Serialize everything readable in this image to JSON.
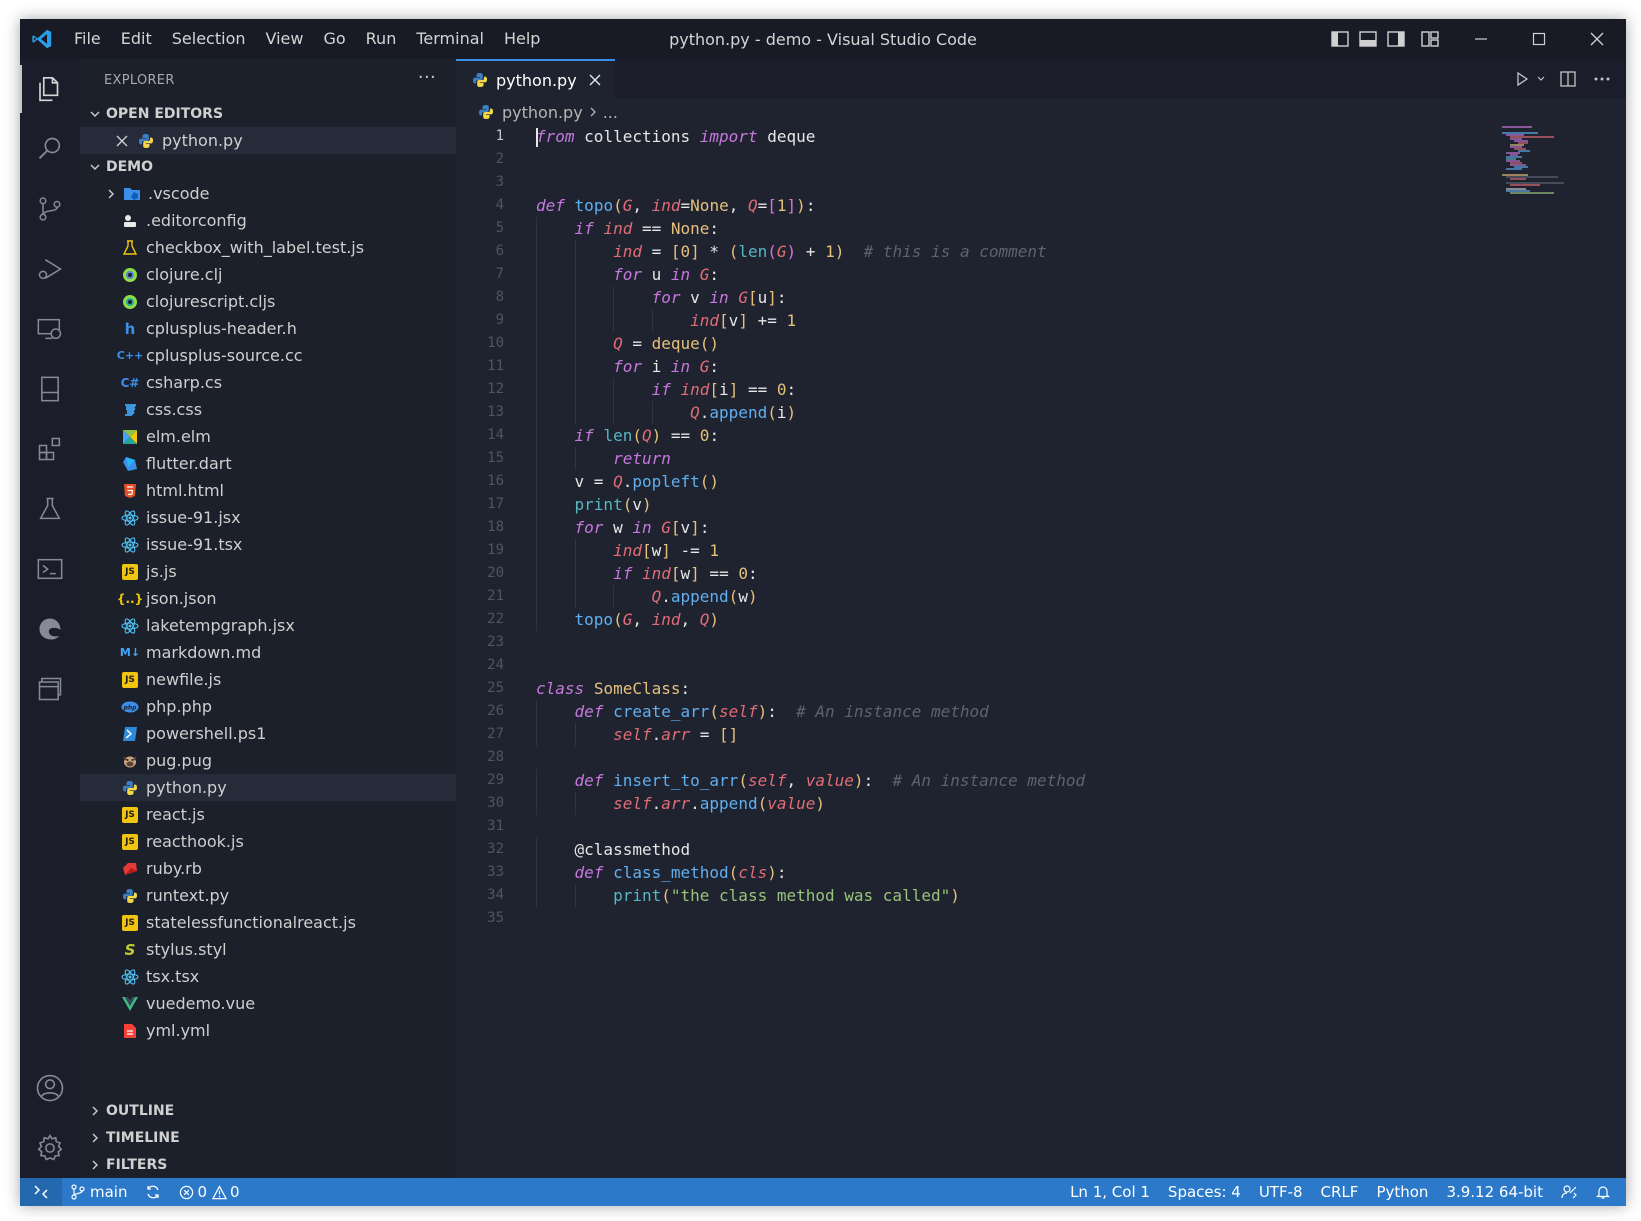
{
  "window_title": "python.py - demo - Visual Studio Code",
  "menu": [
    "File",
    "Edit",
    "Selection",
    "View",
    "Go",
    "Run",
    "Terminal",
    "Help"
  ],
  "sidebar": {
    "header": "EXPLORER",
    "more": "···",
    "open_editors_label": "OPEN EDITORS",
    "open_editor_file": "python.py",
    "folder_label": "DEMO",
    "files": [
      {
        "name": ".vscode",
        "icon": "folder-vscode-icon"
      },
      {
        "name": ".editorconfig",
        "icon": "editorconfig-icon"
      },
      {
        "name": "checkbox_with_label.test.js",
        "icon": "test-flask-icon"
      },
      {
        "name": "clojure.clj",
        "icon": "clojure-icon"
      },
      {
        "name": "clojurescript.cljs",
        "icon": "clojurescript-icon"
      },
      {
        "name": "cplusplus-header.h",
        "icon": "c-header-icon"
      },
      {
        "name": "cplusplus-source.cc",
        "icon": "cpp-icon"
      },
      {
        "name": "csharp.cs",
        "icon": "csharp-icon"
      },
      {
        "name": "css.css",
        "icon": "css-icon"
      },
      {
        "name": "elm.elm",
        "icon": "elm-icon"
      },
      {
        "name": "flutter.dart",
        "icon": "dart-icon"
      },
      {
        "name": "html.html",
        "icon": "html-icon"
      },
      {
        "name": "issue-91.jsx",
        "icon": "react-icon"
      },
      {
        "name": "issue-91.tsx",
        "icon": "react-icon"
      },
      {
        "name": "js.js",
        "icon": "javascript-icon"
      },
      {
        "name": "json.json",
        "icon": "json-icon"
      },
      {
        "name": "laketempgraph.jsx",
        "icon": "react-icon"
      },
      {
        "name": "markdown.md",
        "icon": "markdown-icon"
      },
      {
        "name": "newfile.js",
        "icon": "javascript-icon"
      },
      {
        "name": "php.php",
        "icon": "php-icon"
      },
      {
        "name": "powershell.ps1",
        "icon": "powershell-icon"
      },
      {
        "name": "pug.pug",
        "icon": "pug-icon"
      },
      {
        "name": "python.py",
        "icon": "python-icon",
        "selected": true
      },
      {
        "name": "react.js",
        "icon": "javascript-icon"
      },
      {
        "name": "reacthook.js",
        "icon": "javascript-icon"
      },
      {
        "name": "ruby.rb",
        "icon": "ruby-icon"
      },
      {
        "name": "runtext.py",
        "icon": "python-icon"
      },
      {
        "name": "statelessfunctionalreact.js",
        "icon": "javascript-icon"
      },
      {
        "name": "stylus.styl",
        "icon": "stylus-icon"
      },
      {
        "name": "tsx.tsx",
        "icon": "react-icon"
      },
      {
        "name": "vuedemo.vue",
        "icon": "vue-icon"
      },
      {
        "name": "yml.yml",
        "icon": "yaml-icon"
      }
    ],
    "bottom_sections": [
      "OUTLINE",
      "TIMELINE",
      "FILTERS"
    ]
  },
  "editor": {
    "tab_label": "python.py",
    "breadcrumb_file": "python.py",
    "breadcrumb_rest": "...",
    "current_line": 1
  },
  "statusbar": {
    "branch": "main",
    "errors": "0",
    "warnings": "0",
    "position": "Ln 1, Col 1",
    "spaces": "Spaces: 4",
    "encoding": "UTF-8",
    "eol": "CRLF",
    "language": "Python",
    "interpreter": "3.9.12 64-bit"
  },
  "colors": {
    "accent": "#2b79c8",
    "keyword": "#c678dd",
    "function": "#61afef",
    "string": "#98c379",
    "comment": "#5c6370",
    "variable": "#e06c75",
    "number": "#e5c07b"
  }
}
